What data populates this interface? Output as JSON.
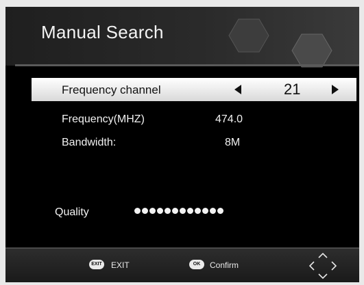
{
  "header": {
    "title": "Manual Search"
  },
  "selected_row": {
    "label": "Frequency channel",
    "value": "21",
    "left_arrow_icon": "arrow-left-icon",
    "right_arrow_icon": "arrow-right-icon"
  },
  "info": {
    "frequency_label": "Frequency(MHZ)",
    "frequency_value": "474.0",
    "bandwidth_label": "Bandwidth:",
    "bandwidth_value": "8M"
  },
  "quality": {
    "label": "Quality",
    "dot_count": 12
  },
  "footer": {
    "exit_key": "EXIT",
    "exit_label": "EXIT",
    "ok_key": "OK",
    "ok_label": "Confirm",
    "nav_icon": "dpad-arrows-icon"
  },
  "colors": {
    "background": "#000000",
    "selected_row": "#e6e6e6",
    "text": "#f2f2f2"
  }
}
